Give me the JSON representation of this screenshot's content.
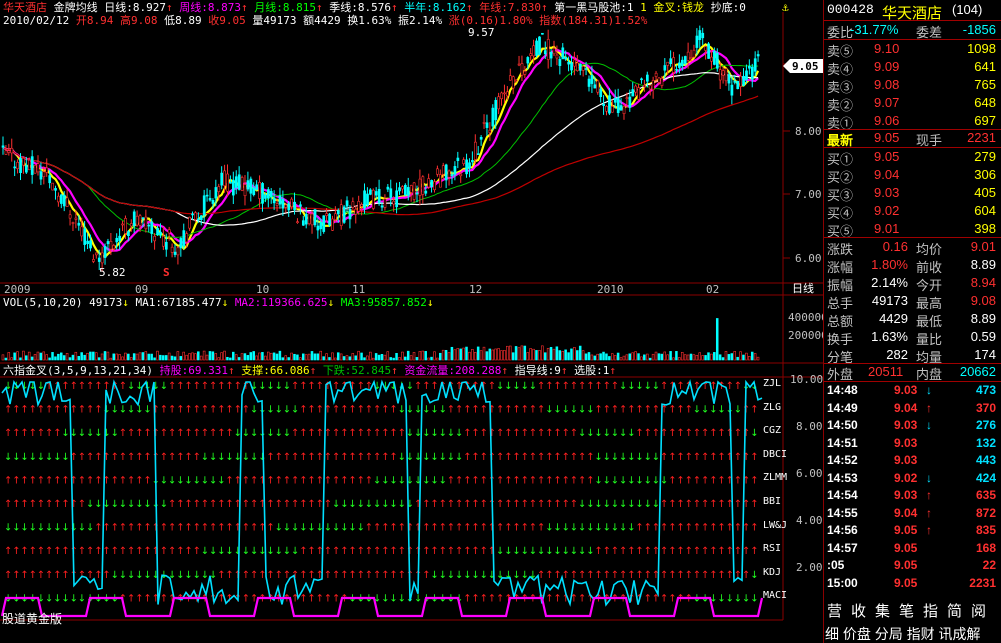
{
  "header": {
    "stock_name": "华天酒店",
    "chart_mode": "金牌均线",
    "ma_day_label": "日线:8.927",
    "ma_week_label": "周线:8.873",
    "ma_month_label": "月线:8.815",
    "ma_season_label": "季线:8.576",
    "ma_half_label": "半年:8.162",
    "ma_year_label": "年线:7.830",
    "pool_label": "第一黑马股池:1",
    "gold_label": "1 金叉:钱龙",
    "bottom_label": "抄底:0",
    "date_label": "2010/02/12",
    "open_label": "开8.94",
    "high_label": "高9.08",
    "low_label": "低8.89",
    "close_label": "收9.05",
    "vol_label": "量49173",
    "amount_label": "额4429",
    "turnover_label": "换1.63%",
    "amplitude_label": "振2.14%",
    "change_label": "涨(0.16)1.80%",
    "index_label": "指数(184.31)1.52%",
    "high_marker": "9.57",
    "low_marker": "5.82",
    "s_marker": "S",
    "current_price_tag": "9.05",
    "price_ticks": [
      "9.00",
      "8.00",
      "7.00",
      "6.00"
    ],
    "date_ticks": [
      "2009",
      "09",
      "10",
      "11",
      "12",
      "2010",
      "02"
    ],
    "period": "日线"
  },
  "volume": {
    "title": "VOL(5,10,20) 49173",
    "ma1": "MA1:67185.477",
    "ma2": "MA2:119366.625",
    "ma3": "MA3:95857.852",
    "ticks": [
      "400000",
      "200000"
    ]
  },
  "indicator": {
    "title": "六指金叉(3,5,9,13,21,34)",
    "hold": "持股:69.331",
    "support": "支撑:66.086",
    "drop": "下跌:52.845",
    "fund": "资金流量:208.288",
    "guide": "指导线:9",
    "pick": "选股:1",
    "row_labels": [
      "ZJL",
      "ZLG",
      "CGZ",
      "DBCI",
      "ZLMM",
      "BBI",
      "LW&J",
      "RSI",
      "KDJ",
      "MACI"
    ],
    "ticks": [
      "10.00",
      "8.00",
      "6.00",
      "4.00",
      "2.00"
    ],
    "version_label": "股道黄金版"
  },
  "quote": {
    "code": "000428",
    "name": "华天酒店",
    "suffix": "(104)",
    "weibi_label": "委比",
    "weibi_value": "-31.77%",
    "weicha_label": "委差",
    "weicha_value": "-1856",
    "asks": [
      {
        "label": "卖⑤",
        "price": "9.10",
        "vol": "1098"
      },
      {
        "label": "卖④",
        "price": "9.09",
        "vol": "641"
      },
      {
        "label": "卖③",
        "price": "9.08",
        "vol": "765"
      },
      {
        "label": "卖②",
        "price": "9.07",
        "vol": "648"
      },
      {
        "label": "卖①",
        "price": "9.06",
        "vol": "697"
      }
    ],
    "last_label": "最新",
    "last_price": "9.05",
    "now_label": "现手",
    "now_vol": "2231",
    "bids": [
      {
        "label": "买①",
        "price": "9.05",
        "vol": "279"
      },
      {
        "label": "买②",
        "price": "9.04",
        "vol": "306"
      },
      {
        "label": "买③",
        "price": "9.03",
        "vol": "405"
      },
      {
        "label": "买④",
        "price": "9.02",
        "vol": "604"
      },
      {
        "label": "买⑤",
        "price": "9.01",
        "vol": "398"
      }
    ],
    "stats": [
      {
        "l1": "涨跌",
        "v1": "0.16",
        "c1": "#ff3030",
        "l2": "均价",
        "v2": "9.01",
        "c2": "#ff3030"
      },
      {
        "l1": "涨幅",
        "v1": "1.80%",
        "c1": "#ff3030",
        "l2": "前收",
        "v2": "8.89",
        "c2": "#ffffff"
      },
      {
        "l1": "振幅",
        "v1": "2.14%",
        "c1": "#ffffff",
        "l2": "今开",
        "v2": "8.94",
        "c2": "#ff3030"
      },
      {
        "l1": "总手",
        "v1": "49173",
        "c1": "#ffffff",
        "l2": "最高",
        "v2": "9.08",
        "c2": "#ff3030"
      },
      {
        "l1": "总额",
        "v1": "4429",
        "c1": "#ffffff",
        "l2": "最低",
        "v2": "8.89",
        "c2": "#ffffff"
      },
      {
        "l1": "换手",
        "v1": "1.63%",
        "c1": "#ffffff",
        "l2": "量比",
        "v2": "0.59",
        "c2": "#ffffff"
      },
      {
        "l1": "分笔",
        "v1": "282",
        "c1": "#ffffff",
        "l2": "均量",
        "v2": "174",
        "c2": "#ffffff"
      }
    ],
    "outer_label": "外盘",
    "outer_value": "20511",
    "inner_label": "内盘",
    "inner_value": "20662",
    "ticks": [
      {
        "time": "14:48",
        "price": "9.03",
        "arrow": "↓",
        "ac": "#00e0ff",
        "vol": "473",
        "vc": "#00e0ff"
      },
      {
        "time": "14:49",
        "price": "9.04",
        "arrow": "↑",
        "ac": "#ff3030",
        "vol": "370",
        "vc": "#ff3030"
      },
      {
        "time": "14:50",
        "price": "9.03",
        "arrow": "↓",
        "ac": "#00e0ff",
        "vol": "276",
        "vc": "#00e0ff"
      },
      {
        "time": "14:51",
        "price": "9.03",
        "arrow": "",
        "ac": "#00e0ff",
        "vol": "132",
        "vc": "#00e0ff"
      },
      {
        "time": "14:52",
        "price": "9.03",
        "arrow": "",
        "ac": "#00e0ff",
        "vol": "443",
        "vc": "#00e0ff"
      },
      {
        "time": "14:53",
        "price": "9.02",
        "arrow": "↓",
        "ac": "#00e0ff",
        "vol": "424",
        "vc": "#00e0ff"
      },
      {
        "time": "14:54",
        "price": "9.03",
        "arrow": "↑",
        "ac": "#ff3030",
        "vol": "635",
        "vc": "#ff3030"
      },
      {
        "time": "14:55",
        "price": "9.04",
        "arrow": "↑",
        "ac": "#ff3030",
        "vol": "872",
        "vc": "#ff3030"
      },
      {
        "time": "14:56",
        "price": "9.05",
        "arrow": "↑",
        "ac": "#ff3030",
        "vol": "835",
        "vc": "#ff3030"
      },
      {
        "time": "14:57",
        "price": "9.05",
        "arrow": "",
        "ac": "#ff3030",
        "vol": "168",
        "vc": "#ff3030"
      },
      {
        "time": ":05",
        "price": "9.05",
        "arrow": "",
        "ac": "#ff3030",
        "vol": "22",
        "vc": "#ff3030"
      },
      {
        "time": "15:00",
        "price": "9.05",
        "arrow": "",
        "ac": "#ff3030",
        "vol": "2231",
        "vc": "#ff3030"
      }
    ],
    "bottom_tabs": [
      "营",
      "收",
      "集",
      "笔",
      "指",
      "简",
      "阅"
    ],
    "bottom_line": "细  价盘 分局 指财 讯成解"
  },
  "colors": {
    "up": "#ff3030",
    "down": "#00ffff",
    "ma_yellow": "#ffff00",
    "ma_magenta": "#ff00ff",
    "ma_green": "#00c000",
    "ma_white": "#ffffff",
    "ma_red": "#c00000",
    "grid": "#8b0000"
  }
}
